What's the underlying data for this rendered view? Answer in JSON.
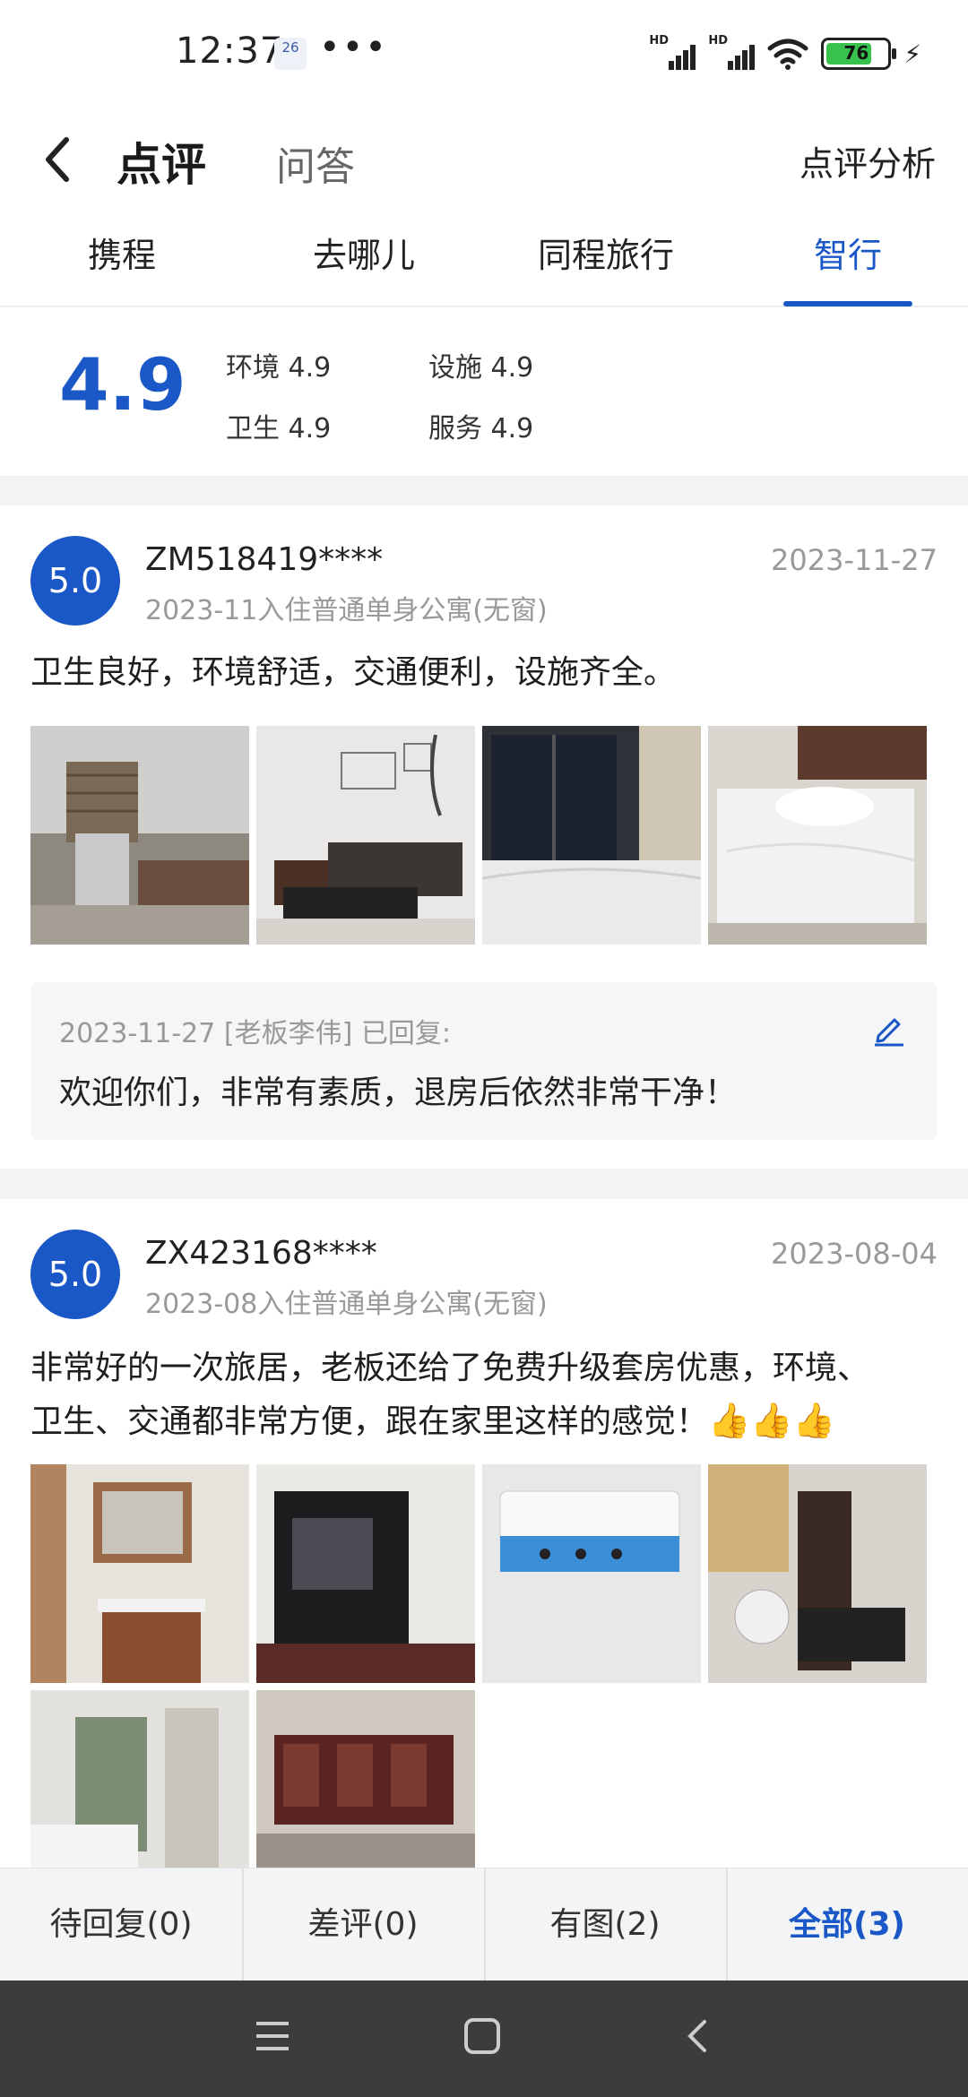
{
  "status_bar": {
    "time": "12:37",
    "calendar_badge": "26",
    "more_dots": "•••",
    "signal_label_1": "HD",
    "signal_label_2": "HD",
    "battery": "76",
    "battery_level": 0.76
  },
  "header": {
    "title": "点评",
    "subtitle_tab": "问答",
    "right_link": "点评分析"
  },
  "source_tabs": [
    "携程",
    "去哪儿",
    "同程旅行",
    "智行"
  ],
  "active_source_tab": "智行",
  "score": {
    "overall": "4.9",
    "sub_scores": [
      {
        "label": "环境 4.9"
      },
      {
        "label": "设施 4.9"
      },
      {
        "label": "卫生 4.9"
      },
      {
        "label": "服务 4.9"
      }
    ]
  },
  "reviews": [
    {
      "rating": "5.0",
      "user": "ZM518419****",
      "date": "2023-11-27",
      "stay": "2023-11入住普通单身公寓(无窗)",
      "text": "卫生良好，环境舒适，交通便利，设施齐全。",
      "reply_meta": "2023-11-27 [老板李伟] 已回复:",
      "reply_text": "欢迎你们，非常有素质，退房后依然非常干净！"
    },
    {
      "rating": "5.0",
      "user": "ZX423168****",
      "date": "2023-08-04",
      "stay": "2023-08入住普通单身公寓(无窗)",
      "text_line1": "非常好的一次旅居，老板还给了免费升级套房优惠，环境、",
      "text_line2": "卫生、交通都非常方便，跟在家里这样的感觉！",
      "emoji": "👍👍👍"
    }
  ],
  "filters": [
    "待回复(0)",
    "差评(0)",
    "有图(2)",
    "全部(3)"
  ],
  "active_filter": "全部(3)",
  "colors": {
    "accent": "#1a57c7",
    "muted_text": "#999999",
    "navbar": "#3c3c3c"
  }
}
